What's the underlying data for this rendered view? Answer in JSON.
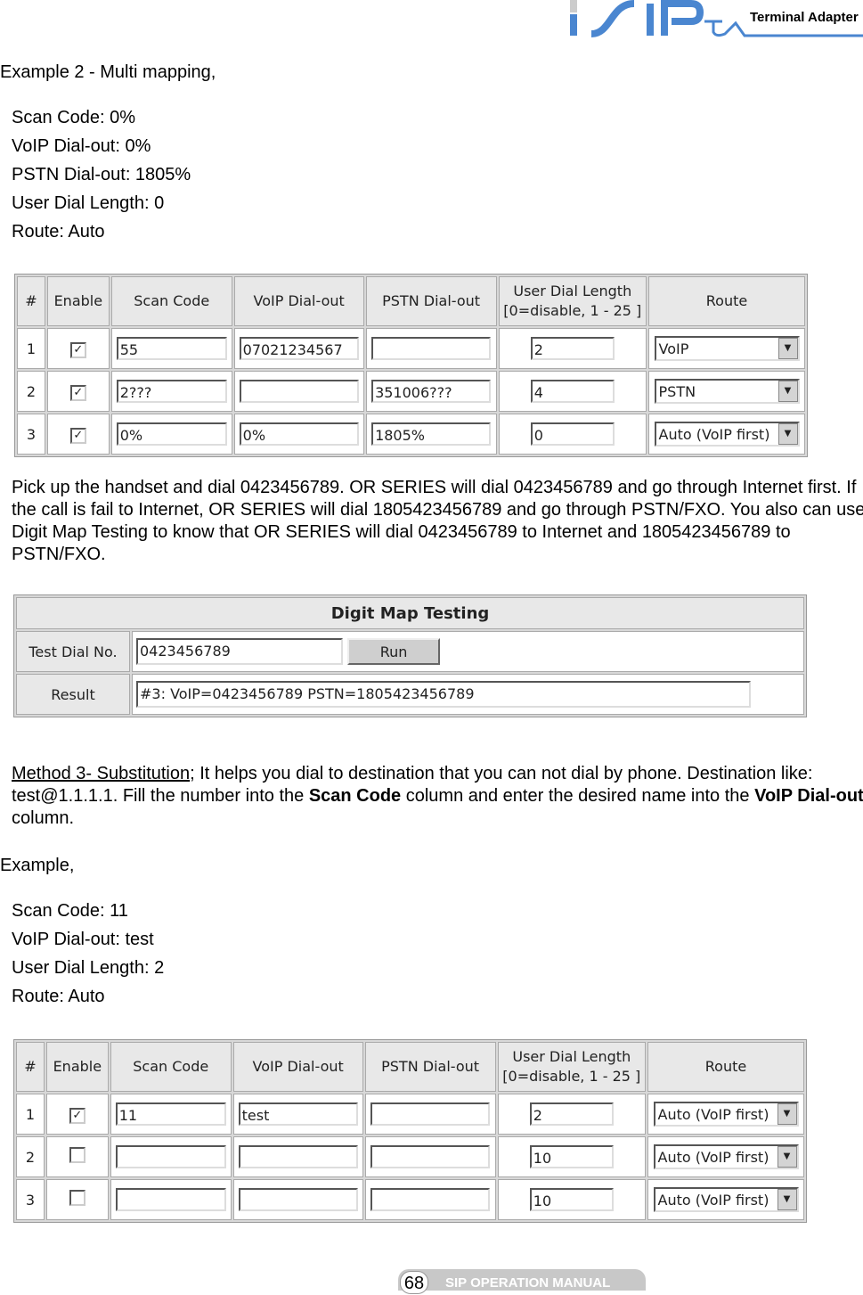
{
  "header": {
    "logo_text": "SIP",
    "product": "Terminal Adapter"
  },
  "example2": {
    "title": "Example 2 - Multi mapping,",
    "settings": [
      "Scan Code: 0%",
      "VoIP Dial-out: 0%",
      "PSTN Dial-out: 1805%",
      "User Dial Length: 0",
      "Route: Auto"
    ]
  },
  "table_headers": [
    "#",
    "Enable",
    "Scan Code",
    "VoIP Dial-out",
    "PSTN Dial-out",
    "User Dial Length\n[0=disable, 1 - 25 ]",
    "Route"
  ],
  "table1": [
    {
      "n": "1",
      "enabled": true,
      "scan": "55",
      "voip": "07021234567",
      "pstn": "",
      "len": "2",
      "route": "VoIP"
    },
    {
      "n": "2",
      "enabled": true,
      "scan": "2???",
      "voip": "",
      "pstn": "351006???",
      "len": "4",
      "route": "PSTN"
    },
    {
      "n": "3",
      "enabled": true,
      "scan": "0%",
      "voip": "0%",
      "pstn": "1805%",
      "len": "0",
      "route": "Auto (VoIP first)"
    }
  ],
  "para1": "Pick up the handset and dial 0423456789. OR SERIES will dial 0423456789 and go through Internet first. If the call is fail to Internet, OR SERIES will dial 1805423456789 and go through PSTN/FXO. You also can use Digit Map Testing to know that OR SERIES will dial 0423456789 to Internet and 1805423456789 to PSTN/FXO.",
  "digitmap": {
    "title": "Digit Map Testing",
    "test_label": "Test Dial No.",
    "test_value": "0423456789",
    "run": "Run",
    "result_label": "Result",
    "result_value": "#3:  VoIP=0423456789  PSTN=1805423456789"
  },
  "method3": {
    "link": "Method 3- Substitution",
    "t1": "; It helps you dial to destination that you can not dial by phone. Destination like: test@1.1.1.1. Fill the number into the ",
    "b1": "Scan Code",
    "t2": " column and enter the desired name into the ",
    "b2": "VoIP Dial-out",
    "t3": " column."
  },
  "example3": {
    "title": "Example,",
    "settings": [
      "Scan Code: 11",
      "VoIP Dial-out: test",
      "User Dial Length: 2",
      "Route: Auto"
    ]
  },
  "table2": [
    {
      "n": "1",
      "enabled": true,
      "scan": "11",
      "voip": "test",
      "pstn": "",
      "len": "2",
      "route": "Auto (VoIP first)"
    },
    {
      "n": "2",
      "enabled": false,
      "scan": "",
      "voip": "",
      "pstn": "",
      "len": "10",
      "route": "Auto (VoIP first)"
    },
    {
      "n": "3",
      "enabled": false,
      "scan": "",
      "voip": "",
      "pstn": "",
      "len": "10",
      "route": "Auto (VoIP first)"
    }
  ],
  "footer": {
    "page": "68",
    "manual": "SIP OPERATION MANUAL"
  },
  "colors": {
    "logo_blue": "#4a86d0",
    "table_bg": "#d8d8d8"
  }
}
